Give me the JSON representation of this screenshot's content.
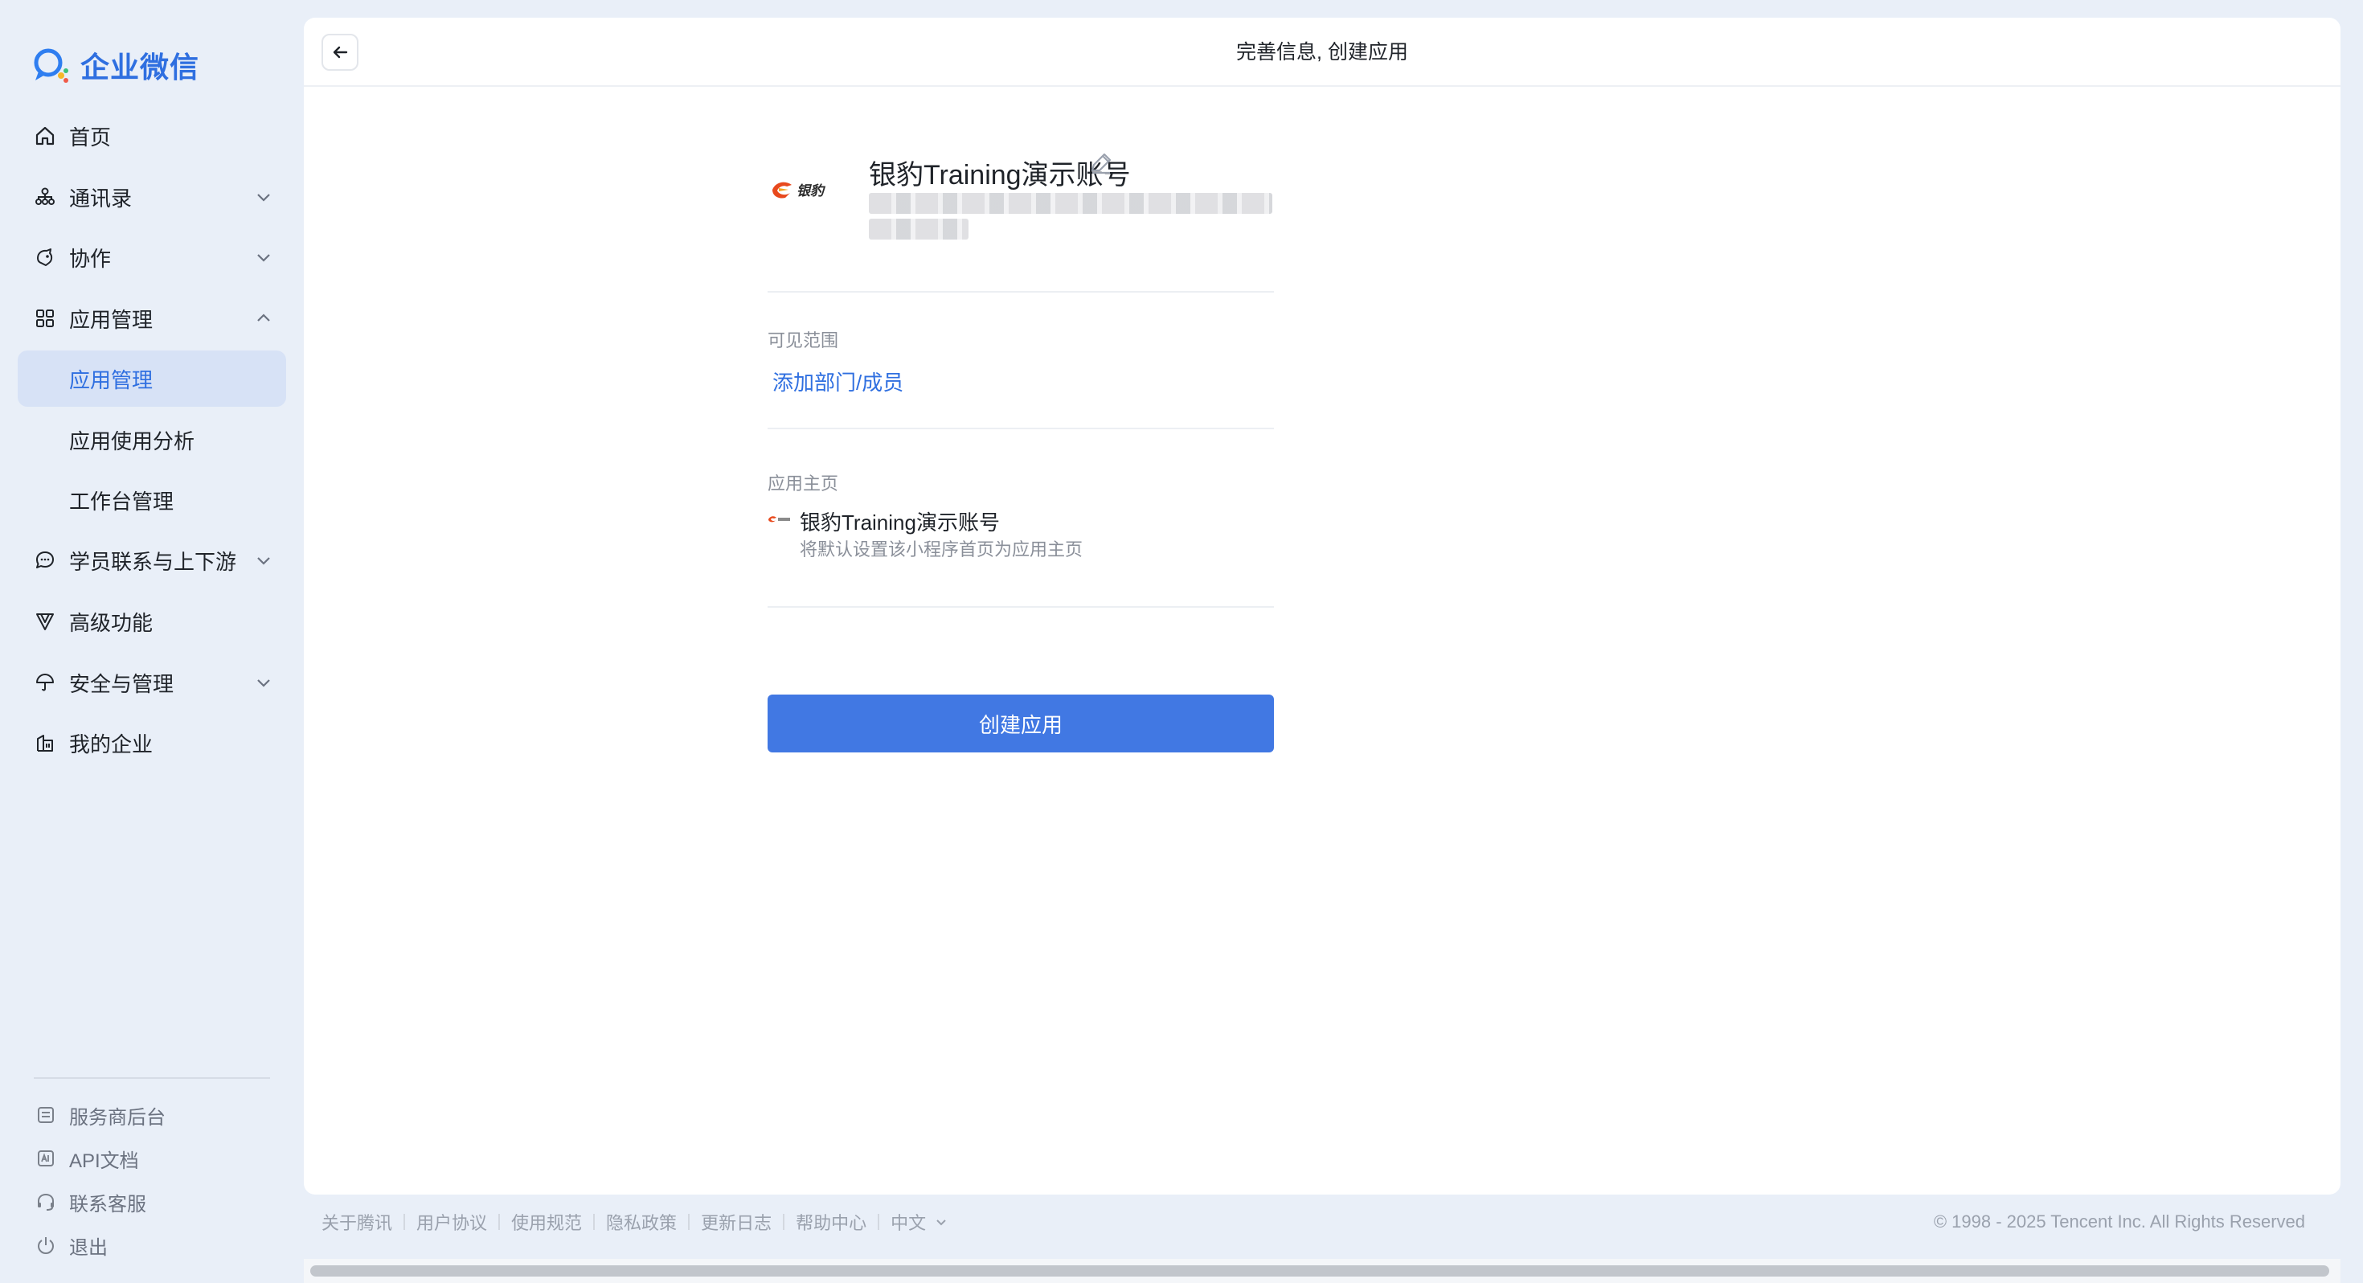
{
  "brand": {
    "name": "企业微信",
    "accent": "#2f6fe0"
  },
  "sidebar": {
    "items": [
      {
        "label": "首页",
        "icon": "home-icon"
      },
      {
        "label": "通讯录",
        "icon": "org-chart-icon"
      },
      {
        "label": "协作",
        "icon": "collaboration-icon"
      },
      {
        "label": "应用管理",
        "icon": "apps-grid-icon"
      },
      {
        "label": "应用管理"
      },
      {
        "label": "应用使用分析"
      },
      {
        "label": "工作台管理"
      },
      {
        "label": "学员联系与上下游",
        "icon": "chat-bubble-icon"
      },
      {
        "label": "高级功能",
        "icon": "vip-icon"
      },
      {
        "label": "安全与管理",
        "icon": "umbrella-icon"
      },
      {
        "label": "我的企业",
        "icon": "building-icon"
      }
    ],
    "footer": [
      {
        "label": "服务商后台",
        "icon": "service-icon"
      },
      {
        "label": "API文档",
        "icon": "api-doc-icon"
      },
      {
        "label": "联系客服",
        "icon": "headset-icon"
      },
      {
        "label": "退出",
        "icon": "power-icon"
      }
    ]
  },
  "header": {
    "title": "完善信息, 创建应用"
  },
  "app": {
    "name": "银豹Training演示账号",
    "logo_text": "银豹"
  },
  "visibility": {
    "label": "可见范围",
    "link": "添加部门/成员"
  },
  "homepage": {
    "label": "应用主页",
    "name": "银豹Training演示账号",
    "desc": "将默认设置该小程序首页为应用主页"
  },
  "create_button": "创建应用",
  "footer": {
    "links": [
      "关于腾讯",
      "用户协议",
      "使用规范",
      "隐私政策",
      "更新日志",
      "帮助中心"
    ],
    "language": "中文",
    "copyright": "© 1998 - 2025 Tencent Inc. All Rights Reserved"
  }
}
